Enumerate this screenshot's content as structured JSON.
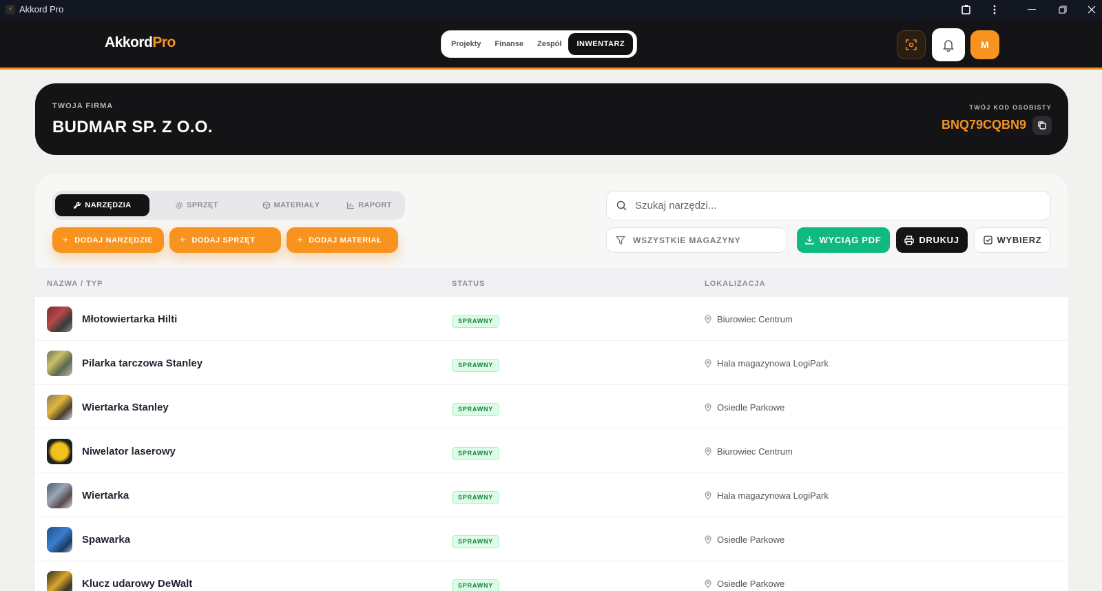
{
  "window": {
    "title": "Akkord Pro"
  },
  "header": {
    "brand_main": "Akkord",
    "brand_accent": "Pro",
    "nav": [
      {
        "label": "Projekty",
        "active": false
      },
      {
        "label": "Finanse",
        "active": false
      },
      {
        "label": "Zespół",
        "active": false
      },
      {
        "label": "INWENTARZ",
        "active": true
      }
    ],
    "avatar_initial": "M",
    "icons": [
      "scan-icon",
      "bell-icon"
    ]
  },
  "company": {
    "label": "TWOJA FIRMA",
    "name": "BUDMAR SP. Z O.O.",
    "code_label": "TWÓJ KOD OSOBISTY",
    "code": "BNQ79CQBN9"
  },
  "tabs": [
    {
      "label": "NARZĘDZIA",
      "icon": "wrench-icon",
      "active": true
    },
    {
      "label": "SPRZĘT",
      "icon": "gear-icon",
      "active": false
    },
    {
      "label": "MATERIAŁY",
      "icon": "box-icon",
      "active": false
    },
    {
      "label": "RAPORT",
      "icon": "chart-icon",
      "active": false
    }
  ],
  "add_buttons": [
    {
      "label": "DODAJ NARZĘDZIE"
    },
    {
      "label": "DODAJ SPRZĘT"
    },
    {
      "label": "DODAJ MATERIAŁ"
    }
  ],
  "search": {
    "placeholder": "Szukaj narzędzi..."
  },
  "filter": {
    "label": "WSZYSTKIE MAGAZYNY"
  },
  "actions": {
    "pdf": "WYCIĄG PDF",
    "print": "DRUKUJ",
    "select": "WYBIERZ"
  },
  "table": {
    "columns": [
      "NAZWA / TYP",
      "STATUS",
      "LOKALIZACJA"
    ],
    "rows": [
      {
        "name": "Młotowiertarka Hilti",
        "status": "SPRAWNY",
        "location": "Biurowiec Centrum"
      },
      {
        "name": "Pilarka tarczowa Stanley",
        "status": "SPRAWNY",
        "location": "Hala magazynowa LogiPark"
      },
      {
        "name": "Wiertarka Stanley",
        "status": "SPRAWNY",
        "location": "Osiedle Parkowe"
      },
      {
        "name": "Niwelator laserowy",
        "status": "SPRAWNY",
        "location": "Biurowiec Centrum"
      },
      {
        "name": "Wiertarka",
        "status": "SPRAWNY",
        "location": "Hala magazynowa LogiPark"
      },
      {
        "name": "Spawarka",
        "status": "SPRAWNY",
        "location": "Osiedle Parkowe"
      },
      {
        "name": "Klucz udarowy DeWalt",
        "status": "SPRAWNY",
        "location": "Osiedle Parkowe"
      }
    ]
  },
  "colors": {
    "accent": "#f7931e",
    "dark": "#141416",
    "success": "#10b981"
  }
}
